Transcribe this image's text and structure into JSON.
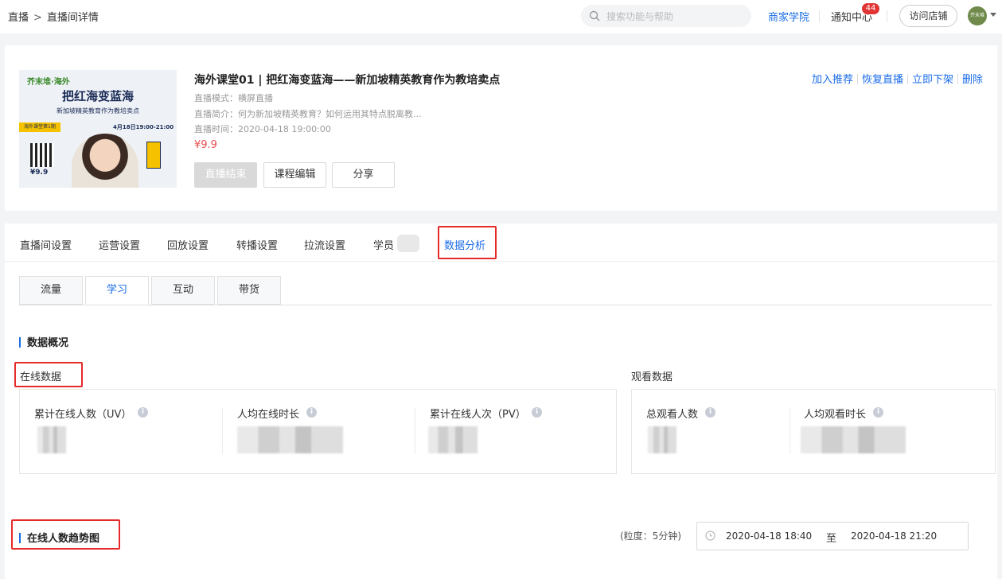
{
  "topbar": {
    "breadcrumb": [
      "直播",
      "直播间详情"
    ],
    "breadcrumb_sep": ">",
    "search_placeholder": "搜索功能与帮助",
    "academy": "商家学院",
    "notice": "通知中心",
    "notice_count": "44",
    "visit_store": "访问店铺",
    "avatar_text": "芥末堆"
  },
  "live": {
    "cover": {
      "brand": "芥末堆·海外",
      "title": "把红海变蓝海",
      "subtitle": "新加坡精英教育作为教培卖点",
      "tag": "海外课堂第1期",
      "date": "4月18日19:00-21:00",
      "price": "¥9.9"
    },
    "title": "海外课堂01 | 把红海变蓝海——新加坡精英教育作为教培卖点",
    "mode": "直播模式：横屏直播",
    "intro": "直播简介：何为新加坡精英教育？如何运用其特点脱离教...",
    "time": "直播时间：2020-04-18 19:00:00",
    "price": "¥9.9",
    "buttons": {
      "ended": "直播结束",
      "edit": "课程编辑",
      "share": "分享"
    },
    "actions": [
      "加入推荐",
      "恢复直播",
      "立即下架",
      "删除"
    ]
  },
  "tabs": [
    "直播间设置",
    "运营设置",
    "回放设置",
    "转播设置",
    "拉流设置",
    "学员",
    "数据分析"
  ],
  "active_tab": "数据分析",
  "subtabs": [
    "流量",
    "学习",
    "互动",
    "带货"
  ],
  "active_subtab": "学习",
  "overview": {
    "title": "数据概况",
    "online": {
      "label": "在线数据",
      "metrics": [
        "累计在线人数（UV）",
        "人均在线时长",
        "累计在线人次（PV）"
      ]
    },
    "watch": {
      "label": "观看数据",
      "metrics": [
        "总观看人数",
        "人均观看时长"
      ]
    }
  },
  "trend": {
    "title": "在线人数趋势图",
    "granularity": "(粒度：5分钟)",
    "start": "2020-04-18 18:40",
    "to": "至",
    "end": "2020-04-18 21:20"
  },
  "colors": {
    "accent": "#1a6ce8",
    "highlight": "#e62929",
    "price": "#e84d4d"
  }
}
